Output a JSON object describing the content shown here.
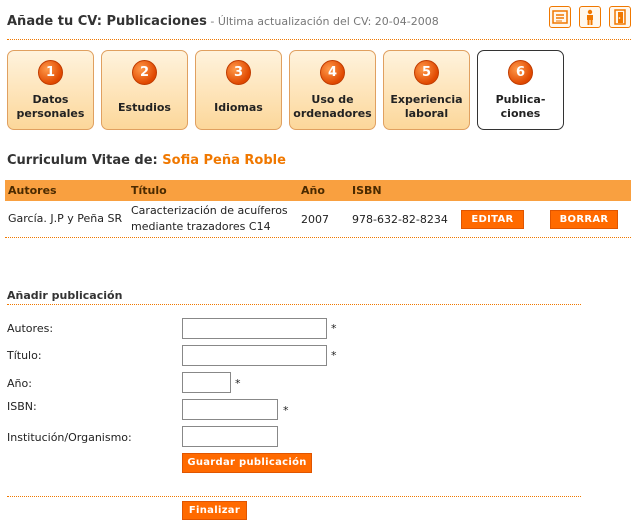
{
  "header": {
    "title": "Añade tu CV: Publicaciones",
    "subtitle": " - Última actualización del CV: 20-04-2008",
    "icons": [
      "document-icon",
      "person-icon",
      "exit-door-icon"
    ]
  },
  "steps": [
    {
      "num": "1",
      "label_line1": "Datos",
      "label_line2": "personales"
    },
    {
      "num": "2",
      "label_line1": "Estudios",
      "label_line2": ""
    },
    {
      "num": "3",
      "label_line1": "Idiomas",
      "label_line2": ""
    },
    {
      "num": "4",
      "label_line1": "Uso de",
      "label_line2": "ordenadores"
    },
    {
      "num": "5",
      "label_line1": "Experiencia",
      "label_line2": "laboral"
    },
    {
      "num": "6",
      "label_line1": "Publica-",
      "label_line2": "ciones"
    }
  ],
  "owner": {
    "prefix": "Curriculum Vitae de: ",
    "name": "Sofia Peña Roble"
  },
  "table": {
    "headers": [
      "Autores",
      "Título",
      "Año",
      "ISBN"
    ],
    "rows": [
      {
        "authors": "García. J.P y Peña SR",
        "title": "Caracterización de acuíferos mediante trazadores C14",
        "year": "2007",
        "isbn": "978-632-82-8234"
      }
    ],
    "edit_label": "EDITAR",
    "delete_label": "BORRAR"
  },
  "form": {
    "title": "Añadir publicación",
    "fields": [
      {
        "label": "Autores:",
        "value": "",
        "required": "*"
      },
      {
        "label": "Título:",
        "value": "",
        "required": "*"
      },
      {
        "label": "Año:",
        "value": "",
        "required": "*"
      },
      {
        "label": "ISBN:",
        "value": "",
        "required": "*"
      },
      {
        "label": "Institución/Organismo:",
        "value": "",
        "required": ""
      }
    ],
    "save_label": "Guardar publicación",
    "finish_label": "Finalizar"
  },
  "colors": {
    "accent": "#f07800",
    "button": "#ff6a00",
    "table_header": "#f9a040"
  }
}
